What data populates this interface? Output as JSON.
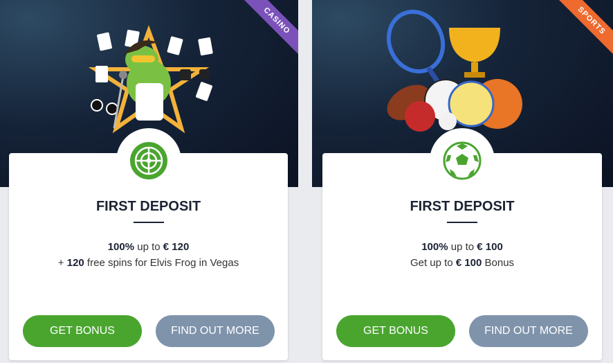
{
  "offers": [
    {
      "ribbon": "CASINO",
      "title": "FIRST DEPOSIT",
      "line1": {
        "bold1": "100%",
        "text1": " up to ",
        "bold2": "€ 120"
      },
      "line2": {
        "prefix": "+ ",
        "bold": "120",
        "text": " free spins for Elvis Frog in Vegas"
      },
      "primary_button": "GET BONUS",
      "secondary_button": "FIND OUT MORE",
      "icon": "roulette-icon"
    },
    {
      "ribbon": "SPORTS",
      "title": "FIRST DEPOSIT",
      "line1": {
        "bold1": "100%",
        "text1": " up to ",
        "bold2": "€ 100"
      },
      "line2": {
        "prefix": "Get up to ",
        "bold": "€ 100",
        "text": " Bonus"
      },
      "primary_button": "GET BONUS",
      "secondary_button": "FIND OUT MORE",
      "icon": "soccer-ball-icon"
    }
  ],
  "colors": {
    "green": "#4aa52f",
    "grey_button": "#7f93ab",
    "casino_ribbon": "#7b52b9",
    "sports_ribbon": "#ee6a2f"
  }
}
